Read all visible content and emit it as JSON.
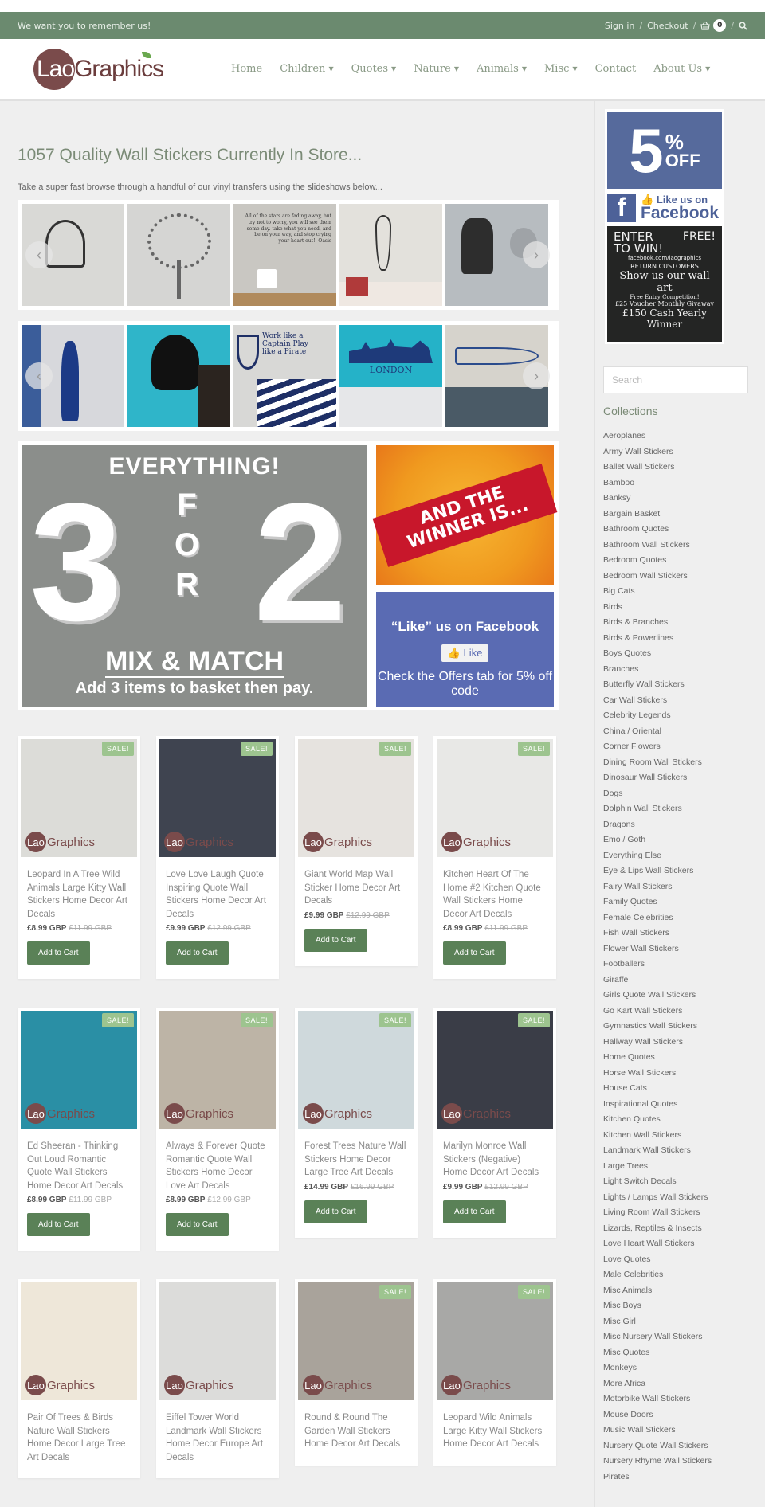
{
  "topbar": {
    "tagline": "We want you to remember us!",
    "sign_in": "Sign in",
    "checkout": "Checkout",
    "cart_count": "0",
    "separator": "/"
  },
  "header": {
    "logo_lao": "Lao",
    "logo_graphics": "Graphics",
    "nav": [
      {
        "label": "Home",
        "has_dropdown": false
      },
      {
        "label": "Children",
        "has_dropdown": true
      },
      {
        "label": "Quotes",
        "has_dropdown": true
      },
      {
        "label": "Nature",
        "has_dropdown": true
      },
      {
        "label": "Animals",
        "has_dropdown": true
      },
      {
        "label": "Misc",
        "has_dropdown": true
      },
      {
        "label": "Contact",
        "has_dropdown": false
      },
      {
        "label": "About Us",
        "has_dropdown": true
      }
    ]
  },
  "main": {
    "title": "1057 Quality Wall Stickers Currently In Store...",
    "intro": "Take a super fast browse through a handful of our vinyl transfers using the slideshows below...",
    "slideshow1": [
      {
        "alt": "BMX rider wall sticker",
        "bg": "#d9d9d6"
      },
      {
        "alt": "Tree wall sticker",
        "bg": "#d5d5d3"
      },
      {
        "alt": "Oasis quote wall sticker",
        "bg": "#c9c7c2"
      },
      {
        "alt": "Wine glass wall sticker",
        "bg": "#e3e1dc"
      },
      {
        "alt": "Banksy soldier wall sticker",
        "bg": "#b7bcc0"
      }
    ],
    "slideshow1_quote": "All of the stars are fading away, but try not to worry, you will see them some day. take what you need, and be on your way, and stop crying your heart out! -Oasis",
    "slideshow2": [
      {
        "alt": "Footballer wall sticker",
        "bg": "#d7d8dc"
      },
      {
        "alt": "Angel wall sticker",
        "bg": "#2fb5c9"
      },
      {
        "alt": "Captain pirate quote wall sticker",
        "bg": "#d8d8d6"
      },
      {
        "alt": "London skyline wall sticker",
        "bg": "#25b2c8"
      },
      {
        "alt": "Trumpet wall sticker",
        "bg": "#d6d3cc"
      }
    ],
    "slideshow2_captions": {
      "captain": "Work like a Captain Play like a Pirate",
      "london": "LONDON"
    },
    "banner": {
      "everything": "EVERYTHING!",
      "three": "3",
      "for": [
        "F",
        "O",
        "R"
      ],
      "two": "2",
      "mix": "MIX & MATCH",
      "add": "Add 3 items to basket then pay."
    },
    "winner_banner": "AND THE WINNER IS...",
    "facebook_banner": {
      "title": "“Like” us on Facebook",
      "like_button": "Like",
      "offer": "Check the Offers tab for 5% off code"
    },
    "products": [
      {
        "title": "Leopard In A Tree Wild Animals Large Kitty Wall Stickers Home Decor Art Decals",
        "price": "£8.99 GBP",
        "was": "£11.99 GBP",
        "sale": true,
        "bg": "#dcdcd8"
      },
      {
        "title": "Love Love Laugh Quote Inspiring Quote Wall Stickers Home Decor Art Decals",
        "price": "£9.99 GBP",
        "was": "£12.99 GBP",
        "sale": true,
        "bg": "#3f4450"
      },
      {
        "title": "Giant World Map Wall Sticker Home Decor Art Decals",
        "price": "£9.99 GBP",
        "was": "£12.99 GBP",
        "sale": true,
        "bg": "#e6e3df"
      },
      {
        "title": "Kitchen Heart Of The Home #2 Kitchen Quote Wall Stickers Home Decor Art Decals",
        "price": "£8.99 GBP",
        "was": "£11.99 GBP",
        "sale": true,
        "bg": "#e8e8e6"
      },
      {
        "title": "Ed Sheeran - Thinking Out Loud Romantic Quote Wall Stickers Home Decor Art Decals",
        "price": "£8.99 GBP",
        "was": "£11.99 GBP",
        "sale": true,
        "bg": "#2a8fa5"
      },
      {
        "title": "Always & Forever Quote Romantic Quote Wall Stickers Home Decor Love Art Decals",
        "price": "£8.99 GBP",
        "was": "£12.99 GBP",
        "sale": true,
        "bg": "#bdb4a6"
      },
      {
        "title": "Forest Trees Nature Wall Stickers Home Decor Large Tree Art Decals",
        "price": "£14.99 GBP",
        "was": "£16.99 GBP",
        "sale": true,
        "bg": "#cfd9dc"
      },
      {
        "title": "Marilyn Monroe Wall Stickers (Negative) Home Decor Art Decals",
        "price": "£9.99 GBP",
        "was": "£12.99 GBP",
        "sale": true,
        "bg": "#3a3d47"
      },
      {
        "title": "Pair Of Trees & Birds Nature Wall Stickers Home Decor Large Tree Art Decals",
        "price": "",
        "was": "",
        "sale": false,
        "bg": "#eee7d9"
      },
      {
        "title": "Eiffel Tower World Landmark Wall Stickers Home Decor Europe Art Decals",
        "price": "",
        "was": "",
        "sale": false,
        "bg": "#dcdcda"
      },
      {
        "title": "Round & Round The Garden Wall Stickers Home Decor Art Decals",
        "price": "",
        "was": "",
        "sale": true,
        "bg": "#a9a39b"
      },
      {
        "title": "Leopard Wild Animals Large Kitty Wall Stickers Home Decor Art Decals",
        "price": "",
        "was": "",
        "sale": true,
        "bg": "#a8a8a6"
      }
    ],
    "sale_label": "SALE!",
    "add_to_cart": "Add to Cart",
    "image_logo_lao": "Lao",
    "image_logo_graphics": "Graphics"
  },
  "sidebar": {
    "promo": {
      "five": "5",
      "percent": "%",
      "off": "OFF",
      "like_us_on": "Like us on",
      "facebook": "Facebook",
      "enter": "ENTER",
      "free": "FREE!",
      "to_win": "TO WIN!",
      "fb_url": "facebook.com/laographics",
      "return_customers": "RETURN CUSTOMERS",
      "show_us": "Show us our wall art",
      "free_entry": "Free Entry Competition!",
      "voucher": "£25 Voucher Monthly Givaway",
      "cash": "£150 Cash Yearly Winner"
    },
    "search_placeholder": "Search",
    "collections_title": "Collections",
    "collections": [
      "Aeroplanes",
      "Army Wall Stickers",
      "Ballet Wall Stickers",
      "Bamboo",
      "Banksy",
      "Bargain Basket",
      "Bathroom Quotes",
      "Bathroom Wall Stickers",
      "Bedroom Quotes",
      "Bedroom Wall Stickers",
      "Big Cats",
      "Birds",
      "Birds & Branches",
      "Birds & Powerlines",
      "Boys Quotes",
      "Branches",
      "Butterfly Wall Stickers",
      "Car Wall Stickers",
      "Celebrity Legends",
      "China / Oriental",
      "Corner Flowers",
      "Dining Room Wall Stickers",
      "Dinosaur Wall Stickers",
      "Dogs",
      "Dolphin Wall Stickers",
      "Dragons",
      "Emo / Goth",
      "Everything Else",
      "Eye & Lips Wall Stickers",
      "Fairy Wall Stickers",
      "Family Quotes",
      "Female Celebrities",
      "Fish Wall Stickers",
      "Flower Wall Stickers",
      "Footballers",
      "Giraffe",
      "Girls Quote Wall Stickers",
      "Go Kart Wall Stickers",
      "Gymnastics Wall Stickers",
      "Hallway Wall Stickers",
      "Home Quotes",
      "Horse Wall Stickers",
      "House Cats",
      "Inspirational Quotes",
      "Kitchen Quotes",
      "Kitchen Wall Stickers",
      "Landmark Wall Stickers",
      "Large Trees",
      "Light Switch Decals",
      "Lights / Lamps Wall Stickers",
      "Living Room Wall Stickers",
      "Lizards, Reptiles & Insects",
      "Love Heart Wall Stickers",
      "Love Quotes",
      "Male Celebrities",
      "Misc Animals",
      "Misc Boys",
      "Misc Girl",
      "Misc Nursery Wall Stickers",
      "Misc Quotes",
      "Monkeys",
      "More Africa",
      "Motorbike Wall Stickers",
      "Mouse Doors",
      "Music Wall Stickers",
      "Nursery Quote Wall Stickers",
      "Nursery Rhyme Wall Stickers",
      "Pirates"
    ]
  }
}
